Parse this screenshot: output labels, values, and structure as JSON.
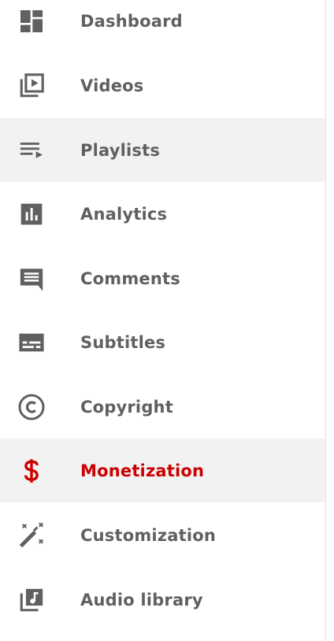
{
  "sidebar": {
    "items": [
      {
        "label": "Dashboard",
        "icon": "dashboard-icon"
      },
      {
        "label": "Videos",
        "icon": "video-library-icon"
      },
      {
        "label": "Playlists",
        "icon": "playlist-icon"
      },
      {
        "label": "Analytics",
        "icon": "analytics-icon"
      },
      {
        "label": "Comments",
        "icon": "comment-icon"
      },
      {
        "label": "Subtitles",
        "icon": "subtitles-icon"
      },
      {
        "label": "Copyright",
        "icon": "copyright-icon"
      },
      {
        "label": "Monetization",
        "icon": "dollar-icon"
      },
      {
        "label": "Customization",
        "icon": "magic-wand-icon"
      },
      {
        "label": "Audio library",
        "icon": "music-library-icon"
      }
    ],
    "hovered_item": "Playlists",
    "active_item": "Monetization"
  },
  "colors": {
    "icon": "#606060",
    "label": "#606060",
    "active": "#cc0000",
    "highlight_bg": "#f2f2f2"
  }
}
